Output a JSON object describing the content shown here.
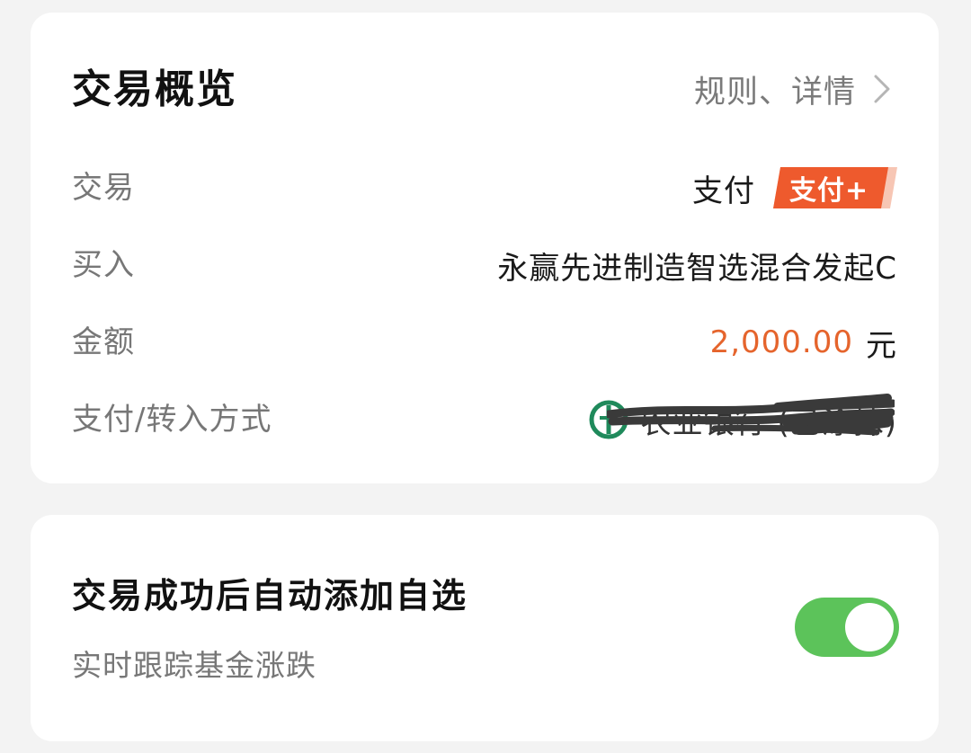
{
  "overview": {
    "title": "交易概览",
    "rules_link": "规则、详情",
    "rows": [
      {
        "label": "交易",
        "value": "支付",
        "badge": "支付+"
      },
      {
        "label": "买入",
        "value": "永赢先进制造智选混合发起C"
      },
      {
        "label": "金额",
        "amount": "2,000.00",
        "unit": "元"
      },
      {
        "label": "支付/转入方式",
        "value": "农业银行 (已涂抹)"
      }
    ]
  },
  "watchlist": {
    "title": "交易成功后自动添加自选",
    "subtitle": "实时跟踪基金涨跌",
    "toggle_on": true
  },
  "colors": {
    "accent_orange": "#e5642c",
    "badge_orange": "#ee5a2d",
    "toggle_green": "#5cc35a",
    "bank_green": "#1f8a5b"
  },
  "icons": [
    "chevron-right-icon",
    "bank-logo-icon"
  ]
}
